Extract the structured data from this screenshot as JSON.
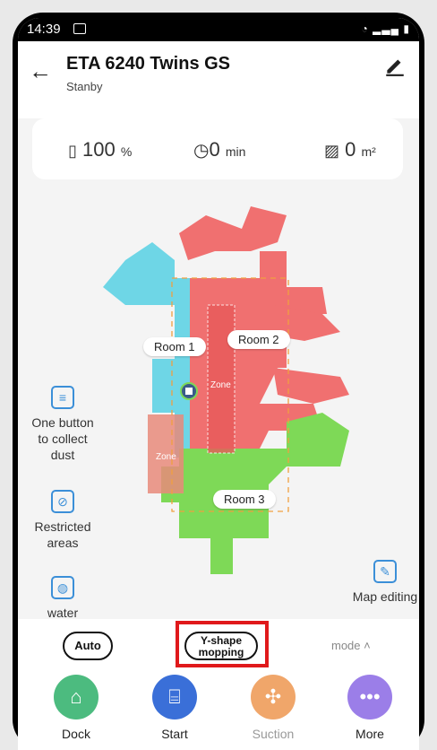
{
  "status": {
    "time": "14:39"
  },
  "device": {
    "name": "ETA 6240 Twins GS",
    "state": "Stanby"
  },
  "stats": {
    "battery_value": "100",
    "battery_unit": "%",
    "time_value": "0",
    "time_unit": "min",
    "area_value": "0",
    "area_unit": "m²"
  },
  "map": {
    "rooms": [
      "Room 1",
      "Room 2",
      "Room 3"
    ],
    "zone_label": "Zone"
  },
  "tools": {
    "collect_dust": "One button to collect dust",
    "restricted": "Restricted areas",
    "water": "water",
    "map_editing": "Map editing"
  },
  "modes": {
    "auto": "Auto",
    "yshape": "Y-shape mopping",
    "mode": "mode"
  },
  "actions": {
    "dock": "Dock",
    "start": "Start",
    "suction": "Suction",
    "more": "More"
  },
  "colors": {
    "room1": "#6ed6e6",
    "room2": "#f07070",
    "room3": "#7ed957",
    "accent": "#3b8fd8",
    "highlight": "#e0191b"
  },
  "icons": {
    "back": "back-arrow-icon",
    "edit": "edit-pencil-icon",
    "battery": "battery-icon",
    "clock": "clock-icon",
    "area": "area-icon"
  }
}
